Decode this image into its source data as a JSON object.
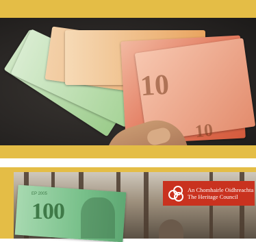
{
  "top_card": {
    "image_note_numbers": [
      "10",
      "10"
    ]
  },
  "bottom_card": {
    "banknote_value": "100",
    "banknote_serial": "EP 2005",
    "logo": {
      "line1": "An Chomhairle Oidhreachta",
      "line2": "The Heritage Council"
    }
  }
}
